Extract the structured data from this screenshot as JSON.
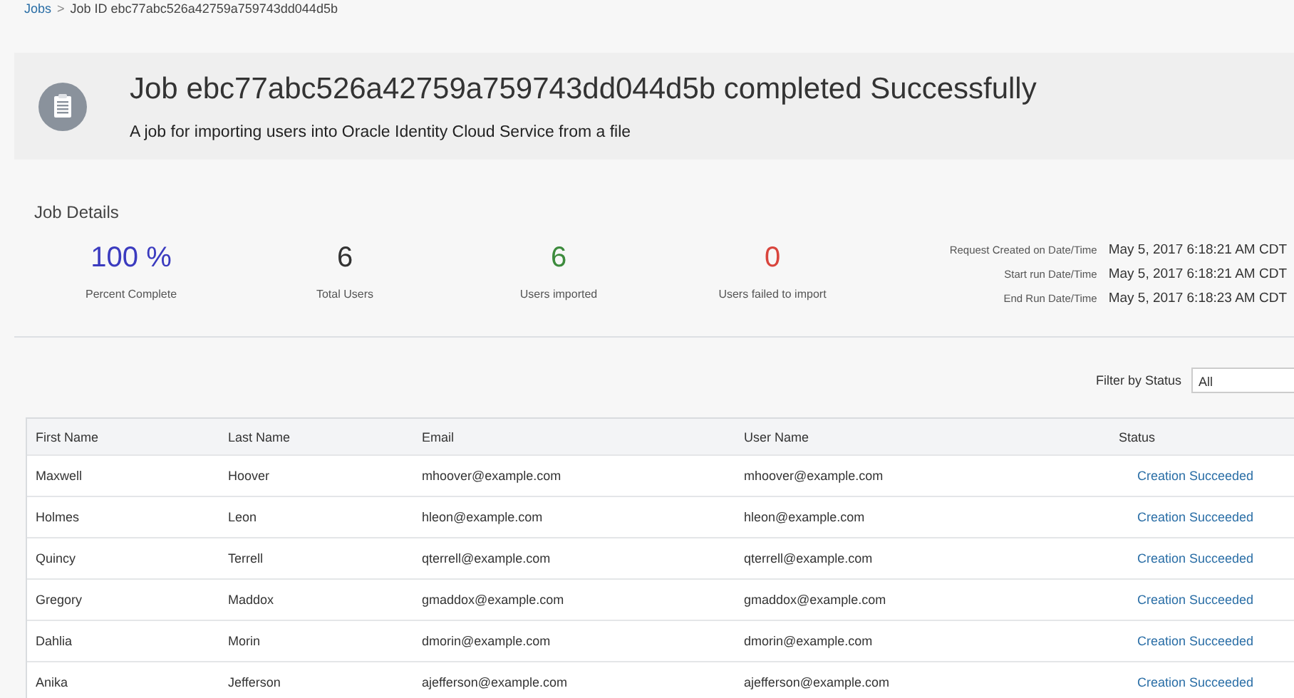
{
  "breadcrumb": [
    {
      "label": "Jobs",
      "kind": "link"
    },
    {
      "label": "Job ID ebc77abc526a42759a759743dd044d5b",
      "kind": "current"
    }
  ],
  "breadcrumb_separator": ">",
  "header": {
    "title": "Job ebc77abc526a42759a759743dd044d5b completed Successfully",
    "description": "A job for importing users into Oracle Identity Cloud Service from a file"
  },
  "job_details": {
    "heading": "Job Details",
    "stats": [
      {
        "value": "100 %",
        "label": "Percent Complete",
        "color": "#3b3bbf"
      },
      {
        "value": "6",
        "label": "Total Users",
        "color": "#333333"
      },
      {
        "value": "6",
        "label": "Users imported",
        "color": "#3d8b3d"
      },
      {
        "value": "0",
        "label": "Users failed to import",
        "color": "#d9453d"
      }
    ],
    "dates": [
      {
        "label": "Request Created on Date/Time",
        "value": "May 5, 2017 6:18:21 AM CDT"
      },
      {
        "label": "Start run Date/Time",
        "value": "May 5, 2017 6:18:21 AM CDT"
      },
      {
        "label": "End Run Date/Time",
        "value": "May 5, 2017 6:18:23 AM CDT"
      }
    ]
  },
  "filter": {
    "label": "Filter by Status",
    "value": "All"
  },
  "table": {
    "columns": [
      "First Name",
      "Last Name",
      "Email",
      "User Name",
      "Status"
    ],
    "rows": [
      [
        "Maxwell",
        "Hoover",
        "mhoover@example.com",
        "mhoover@example.com",
        "Creation Succeeded"
      ],
      [
        "Holmes",
        "Leon",
        "hleon@example.com",
        "hleon@example.com",
        "Creation Succeeded"
      ],
      [
        "Quincy",
        "Terrell",
        "qterrell@example.com",
        "qterrell@example.com",
        "Creation Succeeded"
      ],
      [
        "Gregory",
        "Maddox",
        "gmaddox@example.com",
        "gmaddox@example.com",
        "Creation Succeeded"
      ],
      [
        "Dahlia",
        "Morin",
        "dmorin@example.com",
        "dmorin@example.com",
        "Creation Succeeded"
      ],
      [
        "Anika",
        "Jefferson",
        "ajefferson@example.com",
        "ajefferson@example.com",
        "Creation Succeeded"
      ]
    ]
  }
}
